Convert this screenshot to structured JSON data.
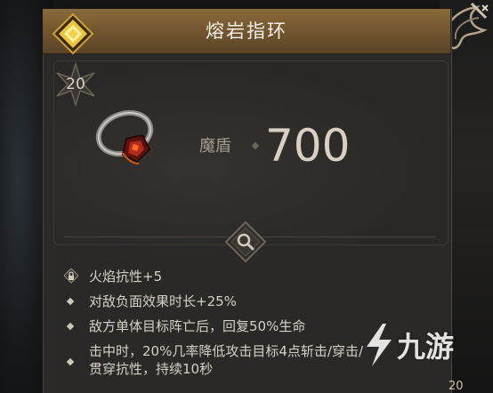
{
  "item": {
    "name": "熔岩指环",
    "level": "20",
    "rarity_color": "#e8c53a",
    "icon": "lava-ring-icon"
  },
  "stat": {
    "name": "魔盾",
    "value": "700"
  },
  "affixes": [
    {
      "marker": "lock-icon",
      "text": "火焰抗性+5"
    },
    {
      "marker": "diamond-bullet",
      "text": "对敌负面效果时长+25%"
    },
    {
      "marker": "diamond-bullet",
      "text": "敌方单体目标阵亡后，回复50%生命"
    },
    {
      "marker": "diamond-bullet",
      "text": "击中时，20%几率降低攻击目标4点斩击/穿击/"
    },
    {
      "marker": "none",
      "text": "贯穿抗性，持续10秒"
    }
  ],
  "inspect_button": {
    "icon": "magnifier-icon"
  },
  "watermark": {
    "text": "九游",
    "logo": "9game-logo"
  },
  "corner_badge": "20",
  "colors": {
    "title_bar": "#7a5c33",
    "panel": "#2b2927",
    "text": "#d6d0c6",
    "stat_value": "#d8d0c4"
  }
}
